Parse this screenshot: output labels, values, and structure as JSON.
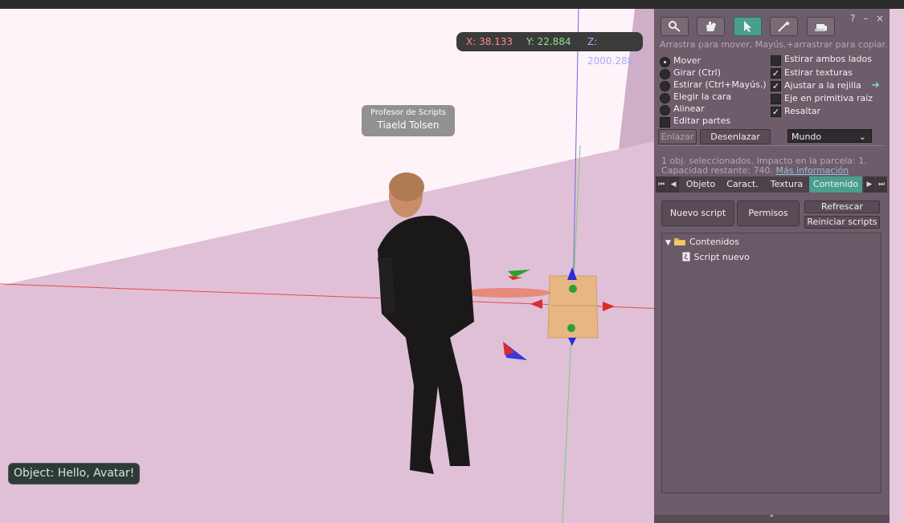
{
  "coords": {
    "x": "X: 38.133",
    "y": "Y: 22.884",
    "z": "Z: 2000.288"
  },
  "nametag": {
    "group": "Profesor de Scripts",
    "name": "Tiaeld Tolsen"
  },
  "chat": {
    "message": "Object: Hello, Avatar!"
  },
  "panel": {
    "window_help": "?",
    "window_min": "–",
    "window_close": "×",
    "hint": "Arrastra para mover, Mayús.+arrastrar para copiar.",
    "modes": [
      {
        "label": "Mover",
        "selected": true
      },
      {
        "label": "Girar (Ctrl)",
        "selected": false
      },
      {
        "label": "Estirar (Ctrl+Mayús.)",
        "selected": false
      },
      {
        "label": "Elegir la cara",
        "selected": false
      },
      {
        "label": "Alinear",
        "selected": false
      }
    ],
    "edit_parts": "Editar partes",
    "options": [
      {
        "label": "Estirar ambos lados",
        "checked": false
      },
      {
        "label": "Estirar texturas",
        "checked": true
      },
      {
        "label": "Ajustar a la rejilla",
        "checked": true
      },
      {
        "label": "Eje en primitiva raíz",
        "checked": false
      },
      {
        "label": "Resaltar",
        "checked": true
      }
    ],
    "link_button": "Enlazar",
    "unlink_button": "Desenlazar",
    "ruler_select": "Mundo",
    "info_line1": "1 obj. seleccionados. Impacto en la parcela: 1.",
    "info_line2": "Capacidad restante: 740.",
    "info_link": "Más información",
    "tabs": [
      "Objeto",
      "Caract.",
      "Textura",
      "Contenido"
    ],
    "active_tab": "Contenido",
    "new_script_button": "Nuevo script",
    "permissions_button": "Permisos",
    "refresh_button": "Refrescar",
    "reset_scripts_button": "Reiniciar scripts",
    "tree": {
      "folder": "Contenidos",
      "item": "Script nuevo"
    },
    "colors": {
      "accent": "#4a9e8d",
      "panel_bg": "#6d5c69"
    }
  }
}
